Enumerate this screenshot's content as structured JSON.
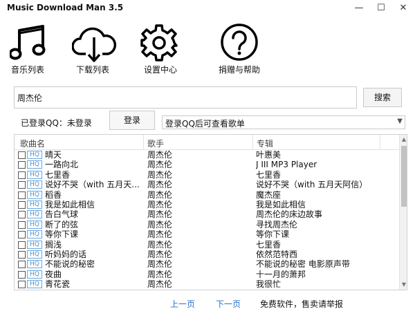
{
  "window": {
    "title": "Music Download Man 3.5",
    "minimize": "—",
    "maximize": "☐",
    "close": "✕"
  },
  "toolbar": {
    "music_list": "音乐列表",
    "download_list": "下载列表",
    "settings": "设置中心",
    "help": "捐赠与帮助"
  },
  "search": {
    "value": "周杰伦",
    "button": "搜索"
  },
  "login": {
    "status": "已登录QQ：未登录",
    "button": "登录",
    "playlist_placeholder": "登录QQ后可查看歌单"
  },
  "table": {
    "headers": [
      "歌曲名",
      "歌手",
      "专辑"
    ],
    "quality_badge": "HQ",
    "rows": [
      [
        "晴天",
        "周杰伦",
        "叶惠美"
      ],
      [
        "一路向北",
        "周杰伦",
        "J III MP3 Player"
      ],
      [
        "七里香",
        "周杰伦",
        "七里香"
      ],
      [
        "说好不哭（with 五月天...",
        "周杰伦",
        "说好不哭（with 五月天阿信）"
      ],
      [
        "稻香",
        "周杰伦",
        "魔杰座"
      ],
      [
        "我是如此相信",
        "周杰伦",
        "我是如此相信"
      ],
      [
        "告白气球",
        "周杰伦",
        "周杰伦的床边故事"
      ],
      [
        "断了的弦",
        "周杰伦",
        "寻找周杰伦"
      ],
      [
        "等你下课",
        "周杰伦",
        "等你下课"
      ],
      [
        "搁浅",
        "周杰伦",
        "七里香"
      ],
      [
        "听妈妈的话",
        "周杰伦",
        "依然范特西"
      ],
      [
        "不能说的秘密",
        "周杰伦",
        "不能说的秘密 电影原声带"
      ],
      [
        "夜曲",
        "周杰伦",
        "十一月的萧邦"
      ],
      [
        "青花瓷",
        "周杰伦",
        "我很忙"
      ]
    ]
  },
  "pagination": {
    "prev": "上一页",
    "next": "下一页"
  },
  "footer": {
    "notice": "免费软件，售卖请举报"
  }
}
